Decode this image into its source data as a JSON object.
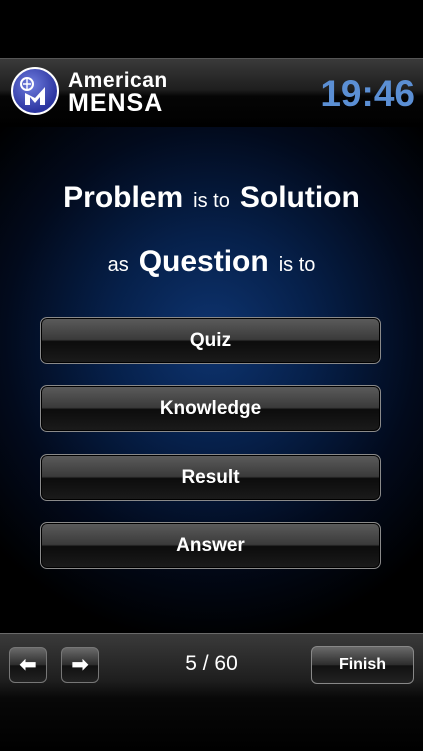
{
  "header": {
    "brand_top": "American",
    "brand_bottom": "MENSA",
    "timer": "19:46"
  },
  "question": {
    "word1": "Problem",
    "connector1": "is to",
    "word2": "Solution",
    "connector2": "as",
    "word3": "Question",
    "connector3": "is to"
  },
  "answers": [
    "Quiz",
    "Knowledge",
    "Result",
    "Answer"
  ],
  "footer": {
    "current": "5",
    "separator": "/",
    "total": "60",
    "finish_label": "Finish",
    "prev_icon": "left-arrow-icon",
    "next_icon": "right-arrow-icon"
  },
  "colors": {
    "timer": "#5b8fd4",
    "background_accent": "#0e3470"
  }
}
